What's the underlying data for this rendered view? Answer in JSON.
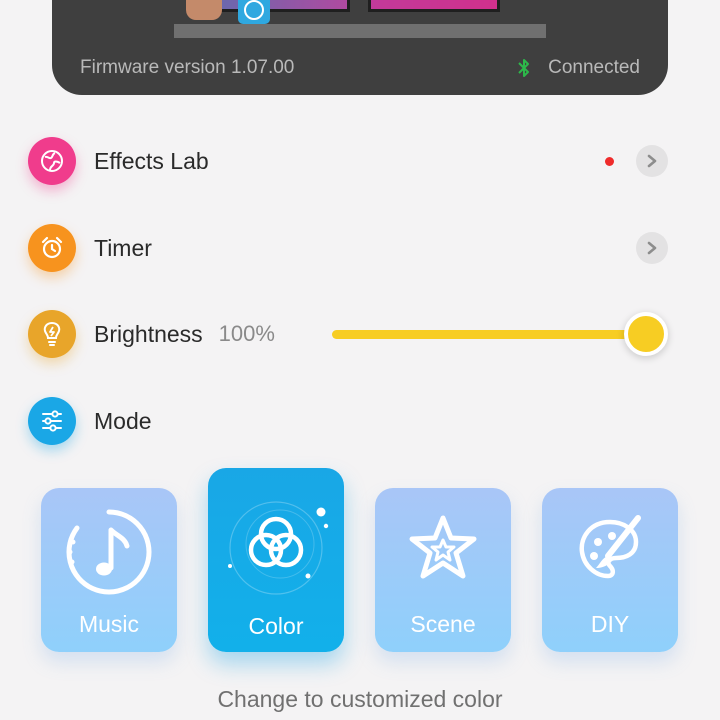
{
  "device": {
    "firmware": "Firmware version 1.07.00",
    "status": "Connected",
    "status_icon": "bluetooth-icon",
    "status_color": "#2db84a"
  },
  "menu": {
    "effects_lab": {
      "label": "Effects Lab",
      "icon": "globe-icon",
      "color": "#f03c8c",
      "has_new_dot": true
    },
    "timer": {
      "label": "Timer",
      "icon": "alarm-clock-icon",
      "color": "#f7931e"
    },
    "brightness": {
      "label": "Brightness",
      "value": "100%",
      "level": 1.0,
      "icon": "lightbulb-icon",
      "color": "#e8a52a",
      "slider_color": "#f7cd23"
    },
    "mode": {
      "label": "Mode",
      "icon": "sliders-icon",
      "color": "#1aa7e6"
    }
  },
  "modes": [
    {
      "label": "Music",
      "icon": "music-note-icon",
      "selected": false
    },
    {
      "label": "Color",
      "icon": "color-circles-icon",
      "selected": true
    },
    {
      "label": "Scene",
      "icon": "star-icon",
      "selected": false
    },
    {
      "label": "DIY",
      "icon": "palette-brush-icon",
      "selected": false
    }
  ],
  "mode_caption": "Change to customized color"
}
